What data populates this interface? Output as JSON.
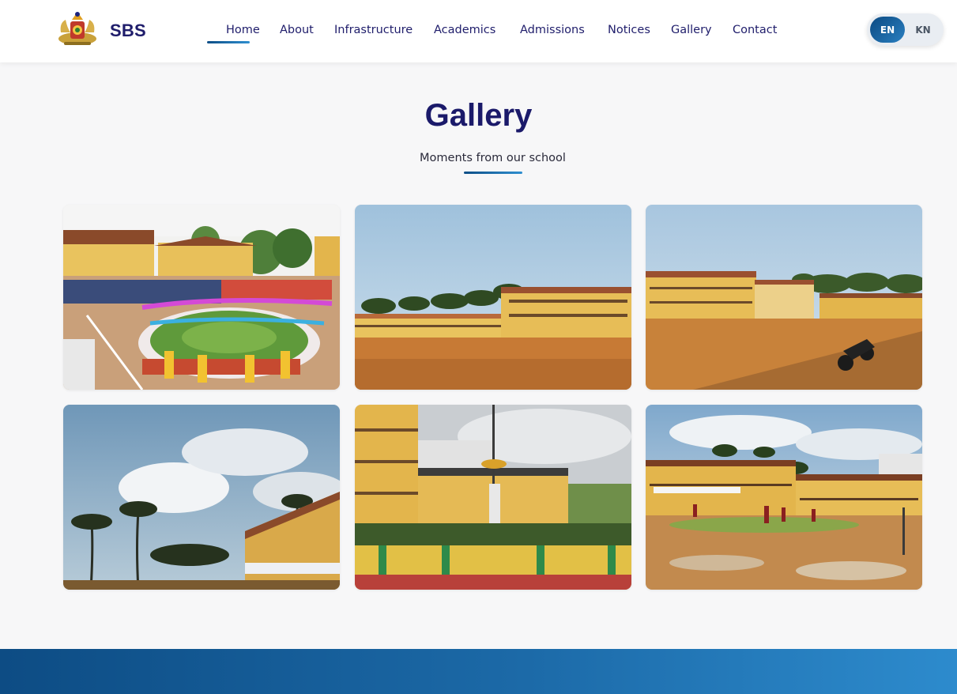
{
  "header": {
    "brand": "SBS",
    "logo_icon": "karnataka-emblem-icon",
    "nav": [
      {
        "label": "Home",
        "active": true
      },
      {
        "label": "About"
      },
      {
        "label": "Infrastructure"
      },
      {
        "label": "Academics"
      },
      {
        "label": "Admissions"
      },
      {
        "label": "Notices"
      },
      {
        "label": "Gallery"
      },
      {
        "label": "Contact"
      }
    ],
    "language": {
      "options": [
        "EN",
        "KN"
      ],
      "selected": "EN"
    }
  },
  "gallery": {
    "title": "Gallery",
    "subtitle": "Moments from our school",
    "images": [
      {
        "name": "gallery-image-assembly-ground"
      },
      {
        "name": "gallery-image-school-building-field"
      },
      {
        "name": "gallery-image-ground-with-motorbike"
      },
      {
        "name": "gallery-image-palms-and-sky"
      },
      {
        "name": "gallery-image-flagpole-garden"
      },
      {
        "name": "gallery-image-courtyard-students"
      }
    ]
  },
  "colors": {
    "navy": "#1f1d6b",
    "accent_blue": "#1c6aa8",
    "background": "#f7f7f8"
  }
}
